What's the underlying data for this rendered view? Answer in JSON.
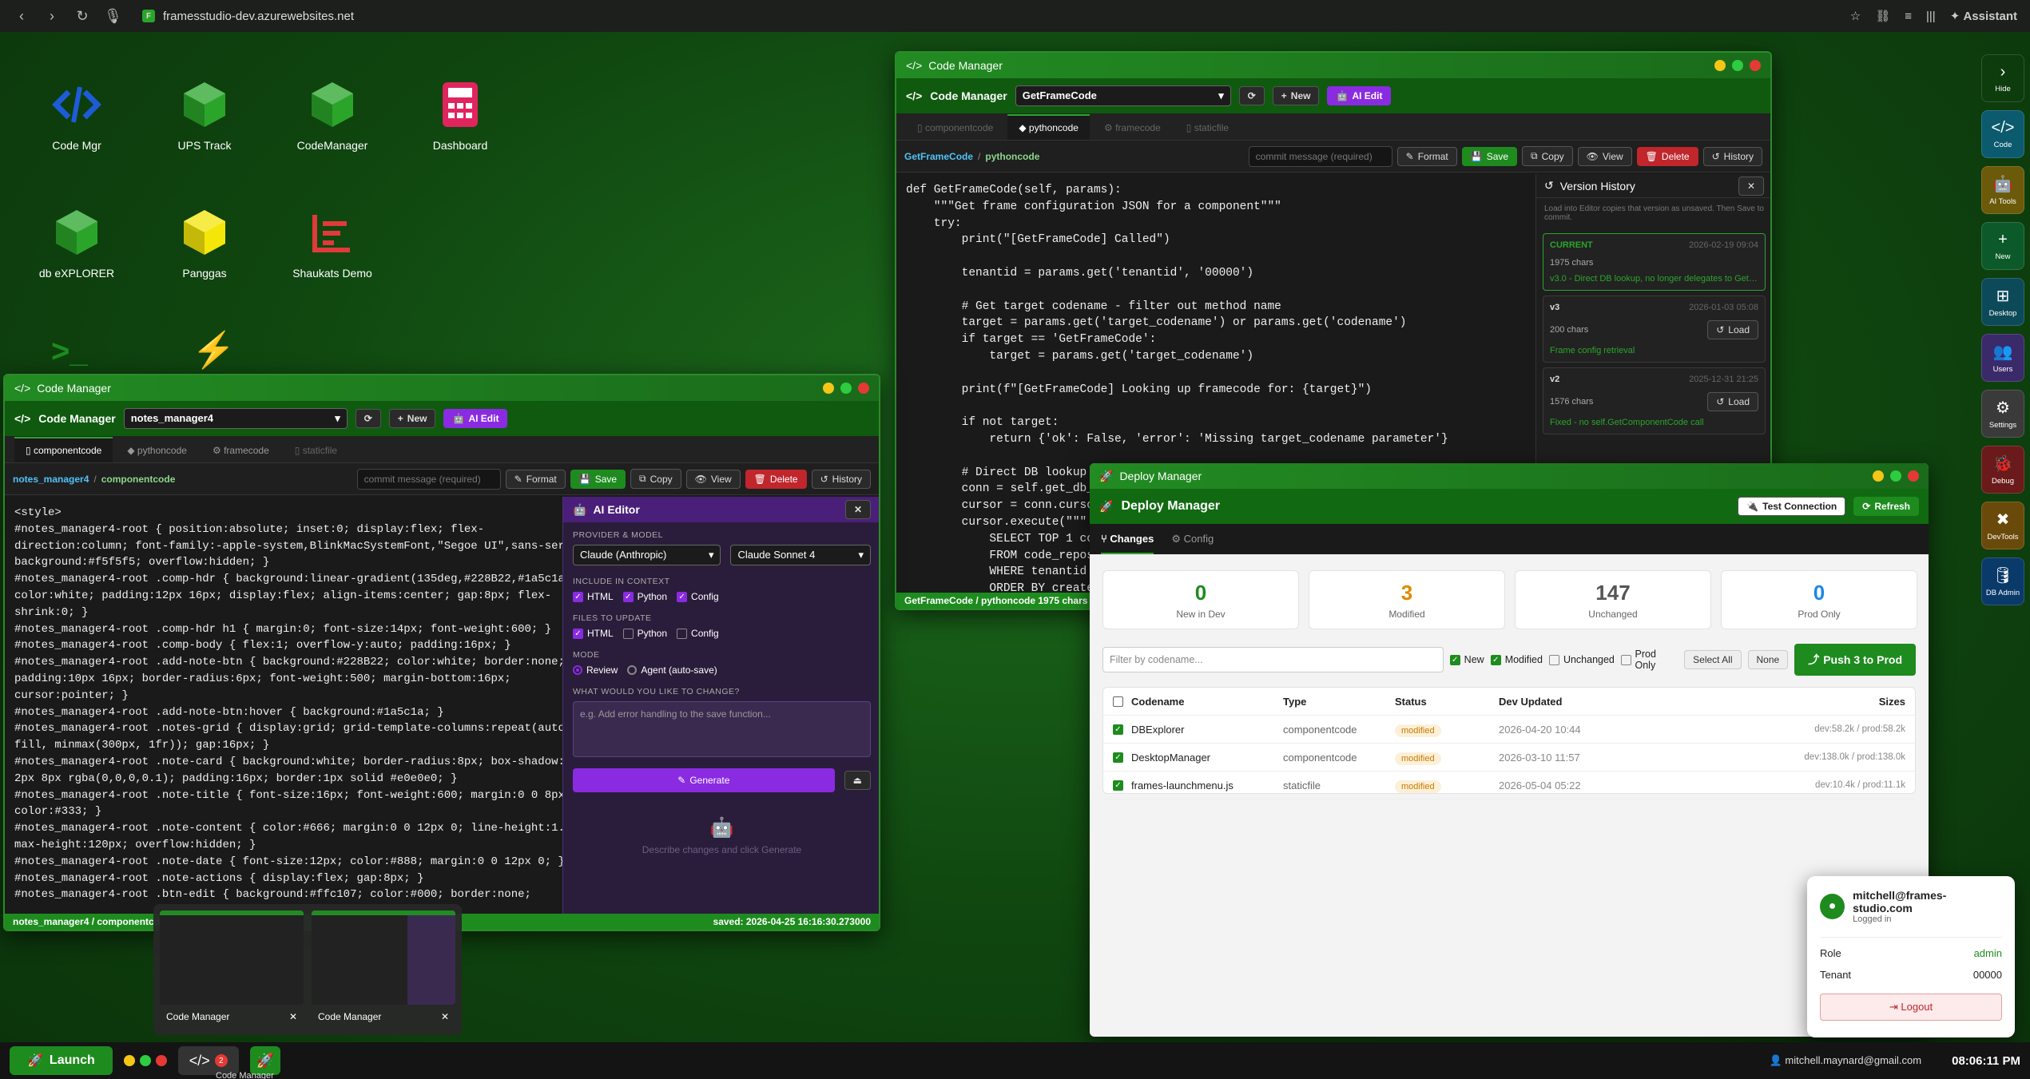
{
  "browser": {
    "url": "framesstudio-dev.azurewebsites.net",
    "assistant": "Assistant",
    "fav": "F"
  },
  "desktop": {
    "icons": [
      {
        "label": "Code Mgr",
        "icon": "code-icon"
      },
      {
        "label": "UPS Track",
        "icon": "cube-icon"
      },
      {
        "label": "CodeManager",
        "icon": "cube-icon"
      },
      {
        "label": "Dashboard",
        "icon": "calculator-icon"
      },
      {
        "label": "db eXPLORER",
        "icon": "cube-icon"
      },
      {
        "label": "Panggas",
        "icon": "cube-icon"
      },
      {
        "label": "Shaukats Demo",
        "icon": "chart-icon"
      }
    ]
  },
  "cm1": {
    "title": "Code Manager",
    "header": "Code Manager",
    "file": "GetFrameCode",
    "new": "New",
    "ai_edit": "AI Edit",
    "tabs": [
      "componentcode",
      "pythoncode",
      "framecode",
      "staticfile"
    ],
    "crumb1": "GetFrameCode",
    "crumb2": "pythoncode",
    "sep": "/",
    "commit_placeholder": "commit message (required)",
    "format": "Format",
    "save": "Save",
    "copy": "Copy",
    "view": "View",
    "delete": "Delete",
    "history": "History",
    "code": "def GetFrameCode(self, params):\n    \"\"\"Get frame configuration JSON for a component\"\"\"\n    try:\n        print(\"[GetFrameCode] Called\")\n\n        tenantid = params.get('tenantid', '00000')\n\n        # Get target codename - filter out method name\n        target = params.get('target_codename') or params.get('codename')\n        if target == 'GetFrameCode':\n            target = params.get('target_codename')\n\n        print(f\"[GetFrameCode] Looking up framecode for: {target}\")\n\n        if not target:\n            return {'ok': False, 'error': 'Missing target_codename parameter'}\n\n        # Direct DB lookup for\n        conn = self.get_db_con\n        cursor = conn.cursor()\n        cursor.execute(\"\"\"\n            SELECT TOP 1 code\n            FROM code_reposit\n            WHERE tenantid = ?\n            ORDER BY created",
    "status": "GetFrameCode / pythoncode 1975 chars",
    "vh": {
      "title": "Version History",
      "hint": "Load into Editor copies that version as unsaved. Then Save to commit.",
      "cards": [
        {
          "tag": "CURRENT",
          "date": "2026-02-19 09:04",
          "chars": "1975 chars",
          "msg": "v3.0 - Direct DB lookup, no longer delegates to GetC..."
        },
        {
          "tag": "v3",
          "date": "2026-01-03 05:08",
          "chars": "200 chars",
          "msg": "Frame config retrieval",
          "load": "Load"
        },
        {
          "tag": "v2",
          "date": "2025-12-31 21:25",
          "chars": "1576 chars",
          "msg": "Fixed - no self.GetComponentCode call",
          "load": "Load"
        }
      ]
    }
  },
  "cm2": {
    "title": "Code Manager",
    "header": "Code Manager",
    "file": "notes_manager4",
    "new": "New",
    "ai_edit": "AI Edit",
    "tabs": [
      "componentcode",
      "pythoncode",
      "framecode",
      "staticfile"
    ],
    "crumb1": "notes_manager4",
    "crumb2": "componentcode",
    "sep": "/",
    "commit_placeholder": "commit message (required)",
    "format": "Format",
    "save": "Save",
    "copy": "Copy",
    "view": "View",
    "delete": "Delete",
    "history": "History",
    "code": "<style>\n#notes_manager4-root { position:absolute; inset:0; display:flex; flex-\ndirection:column; font-family:-apple-system,BlinkMacSystemFont,\"Segoe UI\",sans-serif;\nbackground:#f5f5f5; overflow:hidden; }\n#notes_manager4-root .comp-hdr { background:linear-gradient(135deg,#228B22,#1a5c1a);\ncolor:white; padding:12px 16px; display:flex; align-items:center; gap:8px; flex-\nshrink:0; }\n#notes_manager4-root .comp-hdr h1 { margin:0; font-size:14px; font-weight:600; }\n#notes_manager4-root .comp-body { flex:1; overflow-y:auto; padding:16px; }\n#notes_manager4-root .add-note-btn { background:#228B22; color:white; border:none;\npadding:10px 16px; border-radius:6px; font-weight:500; margin-bottom:16px;\ncursor:pointer; }\n#notes_manager4-root .add-note-btn:hover { background:#1a5c1a; }\n#notes_manager4-root .notes-grid { display:grid; grid-template-columns:repeat(auto-\nfill, minmax(300px, 1fr)); gap:16px; }\n#notes_manager4-root .note-card { background:white; border-radius:8px; box-shadow:0\n2px 8px rgba(0,0,0,0.1); padding:16px; border:1px solid #e0e0e0; }\n#notes_manager4-root .note-title { font-size:16px; font-weight:600; margin:0 0 8px 0;\ncolor:#333; }\n#notes_manager4-root .note-content { color:#666; margin:0 0 12px 0; line-height:1.4;\nmax-height:120px; overflow:hidden; }\n#notes_manager4-root .note-date { font-size:12px; color:#888; margin:0 0 12px 0; }\n#notes_manager4-root .note-actions { display:flex; gap:8px; }\n#notes_manager4-root .btn-edit { background:#ffc107; color:#000; border:none;",
    "status_left": "notes_manager4 / componentcode",
    "status_right": "saved: 2026-04-25 16:16:30.273000",
    "ai": {
      "title": "AI Editor",
      "provider_label": "PROVIDER & MODEL",
      "provider": "Claude (Anthropic)",
      "model": "Claude Sonnet 4",
      "context_label": "INCLUDE IN CONTEXT",
      "files_label": "FILES TO UPDATE",
      "html": "HTML",
      "python": "Python",
      "config": "Config",
      "mode_label": "MODE",
      "review": "Review",
      "agent": "Agent (auto-save)",
      "change_label": "WHAT WOULD YOU LIKE TO CHANGE?",
      "placeholder": "e.g. Add error handling to the save function...",
      "generate": "Generate",
      "hint": "Describe changes and click Generate"
    }
  },
  "dm": {
    "title": "Deploy Manager",
    "header": "Deploy Manager",
    "test": "Test Connection",
    "refresh": "Refresh",
    "tab_changes": "Changes",
    "tab_config": "Config",
    "stats": [
      {
        "n": "0",
        "l": "New in Dev",
        "c": "#1e8b1e"
      },
      {
        "n": "3",
        "l": "Modified",
        "c": "#e08a00"
      },
      {
        "n": "147",
        "l": "Unchanged",
        "c": "#555"
      },
      {
        "n": "0",
        "l": "Prod Only",
        "c": "#1e88e5"
      }
    ],
    "filter_placeholder": "Filter by codename...",
    "f_new": "New",
    "f_modified": "Modified",
    "f_unchanged": "Unchanged",
    "f_prodonly": "Prod Only",
    "select_all": "Select All",
    "none": "None",
    "push": "Push 3 to Prod",
    "cols": [
      "Codename",
      "Type",
      "Status",
      "Dev Updated",
      "Sizes"
    ],
    "rows": [
      {
        "name": "DBExplorer",
        "type": "componentcode",
        "status": "modified",
        "date": "2026-04-20 10:44",
        "sizes": "dev:58.2k / prod:58.2k"
      },
      {
        "name": "DesktopManager",
        "type": "componentcode",
        "status": "modified",
        "date": "2026-03-10 11:57",
        "sizes": "dev:138.0k / prod:138.0k"
      },
      {
        "name": "frames-launchmenu.js",
        "type": "staticfile",
        "status": "modified",
        "date": "2026-05-04 05:22",
        "sizes": "dev:10.4k / prod:11.1k"
      }
    ]
  },
  "rightbar": [
    {
      "label": "Hide",
      "icon": "chevron-right-icon",
      "g": "›"
    },
    {
      "label": "Code",
      "icon": "code-icon",
      "g": "</>"
    },
    {
      "label": "AI Tools",
      "icon": "robot-icon",
      "g": "🤖"
    },
    {
      "label": "New",
      "icon": "plus-icon",
      "g": "+"
    },
    {
      "label": "Desktop",
      "icon": "grid-icon",
      "g": "⊞"
    },
    {
      "label": "Users",
      "icon": "users-icon",
      "g": "👥"
    },
    {
      "label": "Settings",
      "icon": "gear-icon",
      "g": "⚙"
    },
    {
      "label": "Debug",
      "icon": "bug-icon",
      "g": "🐞"
    },
    {
      "label": "DevTools",
      "icon": "tools-icon",
      "g": "✖"
    },
    {
      "label": "DB Admin",
      "icon": "database-icon",
      "g": "🛢"
    }
  ],
  "taskbar": {
    "launch": "Launch",
    "badge": "2",
    "tooltip": "Code Manager",
    "email": "mitchell.maynard@gmail.com",
    "time": "08:06:11 PM"
  },
  "thumbs": [
    {
      "label": "Code Manager"
    },
    {
      "label": "Code Manager"
    }
  ],
  "user": {
    "email": "mitchell@frames-studio.com",
    "status": "Logged in",
    "role_label": "Role",
    "role": "admin",
    "tenant_label": "Tenant",
    "tenant": "00000",
    "logout": "Logout"
  }
}
